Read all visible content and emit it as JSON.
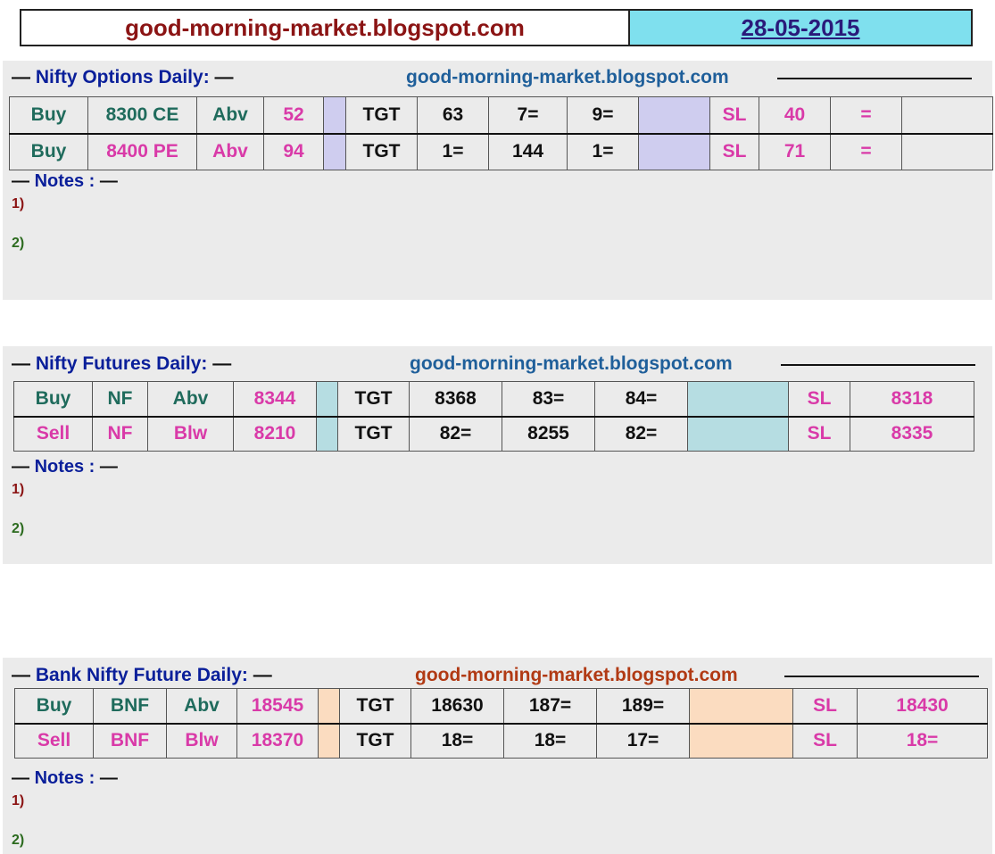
{
  "header": {
    "site": "good-morning-market.blogspot.com",
    "date": "28-05-2015"
  },
  "options": {
    "title": "Nifty  Options  Daily:",
    "site": "good-morning-market.blogspot.com",
    "rows": [
      [
        "Buy",
        "8300 CE",
        "Abv",
        "52",
        "",
        "TGT",
        "63",
        "7=",
        "9=",
        "",
        "SL",
        "40",
        "=",
        ""
      ],
      [
        "Buy",
        "8400 PE",
        "Abv",
        "94",
        "",
        "TGT",
        "1=",
        "144",
        "1=",
        "",
        "SL",
        "71",
        "=",
        ""
      ]
    ],
    "notes_label": "Notes :",
    "note1": "1)",
    "note2": "2)"
  },
  "futures": {
    "title": "Nifty Futures  Daily:",
    "site": "good-morning-market.blogspot.com",
    "rows": [
      [
        "Buy",
        "NF",
        "Abv",
        "8344",
        "",
        "TGT",
        "8368",
        "83=",
        "84=",
        "",
        "SL",
        "8318"
      ],
      [
        "Sell",
        "NF",
        "Blw",
        "8210",
        "",
        "TGT",
        "82=",
        "8255",
        "82=",
        "",
        "SL",
        "8335"
      ]
    ],
    "notes_label": "Notes :",
    "note1": "1)",
    "note2": "2)"
  },
  "banknifty": {
    "title": "Bank Nifty Future  Daily:",
    "site": "good-morning-market.blogspot.com",
    "rows": [
      [
        "Buy",
        "BNF",
        "Abv",
        "18545",
        "",
        "TGT",
        "18630",
        "187=",
        "189=",
        "",
        "SL",
        "18430"
      ],
      [
        "Sell",
        "BNF",
        "Blw",
        "18370",
        "",
        "TGT",
        "18=",
        "18=",
        "17=",
        "",
        "SL",
        "18="
      ]
    ],
    "notes_label": "Notes :",
    "note1": "1)",
    "note2": "2)"
  },
  "colors": {
    "options_spacer": "#cfcdef",
    "futures_spacer": "#b6dde2",
    "banknifty_spacer": "#fbdcc0",
    "header_date_bg": "#7fe0ee",
    "section_bg": "#ebebeb"
  }
}
